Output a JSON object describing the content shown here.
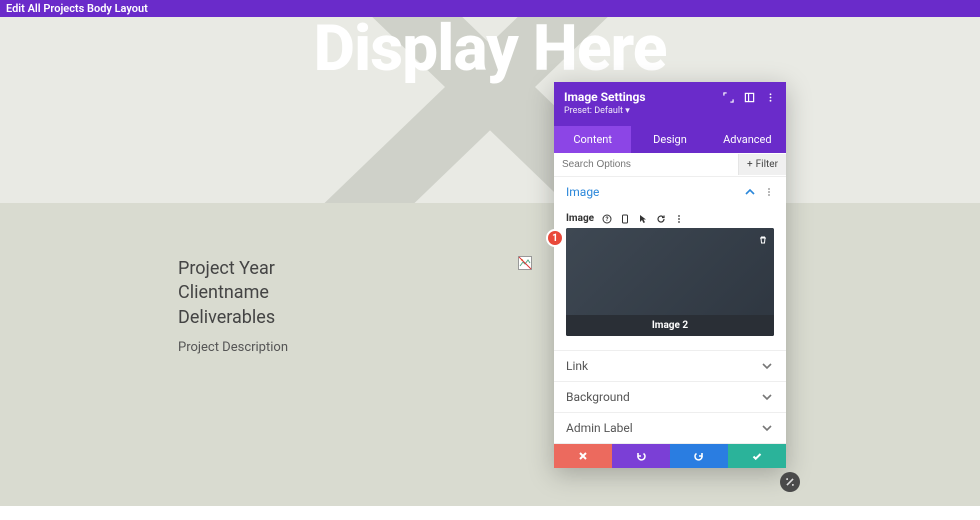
{
  "topbar": {
    "title": "Edit All Projects Body Layout"
  },
  "hero": {
    "headline": "Display Here"
  },
  "content": {
    "line1": "Project Year",
    "line2": "Clientname",
    "line3": "Deliverables",
    "description": "Project Description"
  },
  "badge": {
    "number": "1"
  },
  "panel": {
    "title": "Image Settings",
    "preset": "Preset: Default ",
    "tabs": {
      "content": "Content",
      "design": "Design",
      "advanced": "Advanced"
    },
    "search_placeholder": "Search Options",
    "filter_label": "Filter",
    "sections": {
      "image": {
        "title": "Image",
        "field_label": "Image",
        "preview_label": "Image 2"
      },
      "link": "Link",
      "background": "Background",
      "admin_label": "Admin Label"
    }
  }
}
